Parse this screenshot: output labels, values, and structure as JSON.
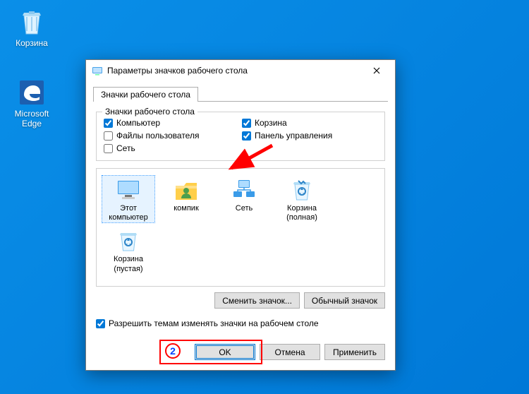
{
  "desktop": {
    "recycle_bin": "Корзина",
    "edge": "Microsoft Edge"
  },
  "dialog": {
    "title": "Параметры значков рабочего стола",
    "tab": "Значки рабочего стола",
    "group_legend": "Значки рабочего стола",
    "checkboxes": {
      "computer": {
        "label": "Компьютер",
        "checked": true
      },
      "userfiles": {
        "label": "Файлы пользователя",
        "checked": false
      },
      "network": {
        "label": "Сеть",
        "checked": false
      },
      "recycle": {
        "label": "Корзина",
        "checked": true
      },
      "cpanel": {
        "label": "Панель управления",
        "checked": true
      }
    },
    "icons": {
      "this_pc": "Этот компьютер",
      "kompik": "компик",
      "network": "Сеть",
      "bin_full": "Корзина (полная)",
      "bin_empty": "Корзина (пустая)"
    },
    "change_icon": "Сменить значок...",
    "default_icon": "Обычный значок",
    "allow_themes": {
      "label": "Разрешить темам изменять значки на рабочем столе",
      "checked": true
    },
    "ok": "OK",
    "cancel": "Отмена",
    "apply": "Применить"
  },
  "annotation": {
    "step": "2"
  }
}
